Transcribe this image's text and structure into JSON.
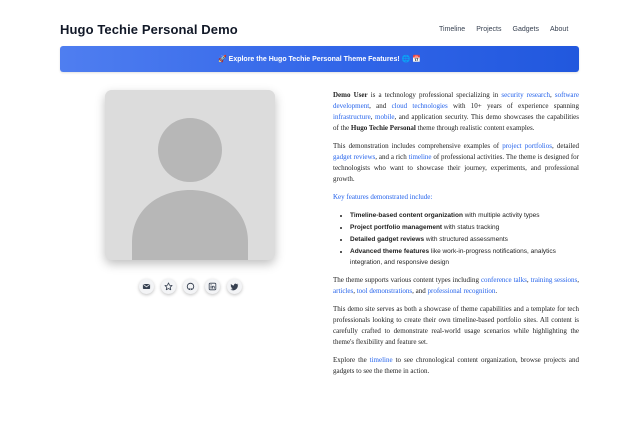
{
  "header": {
    "title": "Hugo Techie Personal Demo"
  },
  "nav": {
    "items": [
      "Timeline",
      "Projects",
      "Gadgets",
      "About"
    ]
  },
  "banner": {
    "text": "🚀 Explore the Hugo Techie Personal Theme Features! 🌐 📅"
  },
  "social": {
    "icons": [
      "email-icon",
      "kofi-icon",
      "github-icon",
      "linkedin-icon",
      "twitter-icon"
    ]
  },
  "intro": {
    "p1": {
      "name": "Demo User",
      "t1": " is a technology professional specializing in ",
      "l1": "security research",
      "t2": ", ",
      "l2": "software development",
      "t3": ", and ",
      "l3": "cloud technologies",
      "t4": " with 10+ years of experience spanning ",
      "l4": "infrastructure",
      "t5": ", ",
      "l5": "mobile",
      "t6": ", and application security. This demo showcases the capabilities of the ",
      "strong": "Hugo Techie Personal",
      "t7": " theme through realistic content examples."
    },
    "p2": {
      "t1": "This demonstration includes comprehensive examples of ",
      "l1": "project portfolios",
      "t2": ", detailed ",
      "l2": "gadget reviews",
      "t3": ", and a rich ",
      "l3": "timeline",
      "t4": " of professional activities. The theme is designed for technologists who want to showcase their journey, experiments, and professional growth."
    },
    "features_heading": "Key features demonstrated include:",
    "features": [
      {
        "bold": "Timeline-based content organization",
        "text": " with multiple activity types"
      },
      {
        "bold": "Project portfolio management",
        "text": " with status tracking"
      },
      {
        "bold": "Detailed gadget reviews",
        "text": " with structured assessments"
      },
      {
        "bold": "Advanced theme features",
        "text": " like work-in-progress notifications, analytics integration, and responsive design"
      }
    ],
    "p3": {
      "t1": "The theme supports various content types including ",
      "l1": "conference talks",
      "t2": ", ",
      "l2": "training sessions",
      "t3": ", ",
      "l3": "articles",
      "t4": ", ",
      "l4": "tool demonstrations",
      "t5": ", and ",
      "l5": "professional recognition",
      "t6": "."
    },
    "p4": "This demo site serves as both a showcase of theme capabilities and a template for tech professionals looking to create their own timeline-based portfolio sites. All content is carefully crafted to demonstrate real-world usage scenarios while highlighting the theme's flexibility and feature set.",
    "p5": {
      "t1": "Explore the ",
      "l1": "timeline",
      "t2": " to see chronological content organization, browse projects and gadgets to see the theme in action."
    }
  },
  "colors": {
    "accent": "#2563eb",
    "banner": "#3165e8",
    "avatar_bg": "#dcdcdc",
    "avatar_fg": "#b7b7b7"
  }
}
